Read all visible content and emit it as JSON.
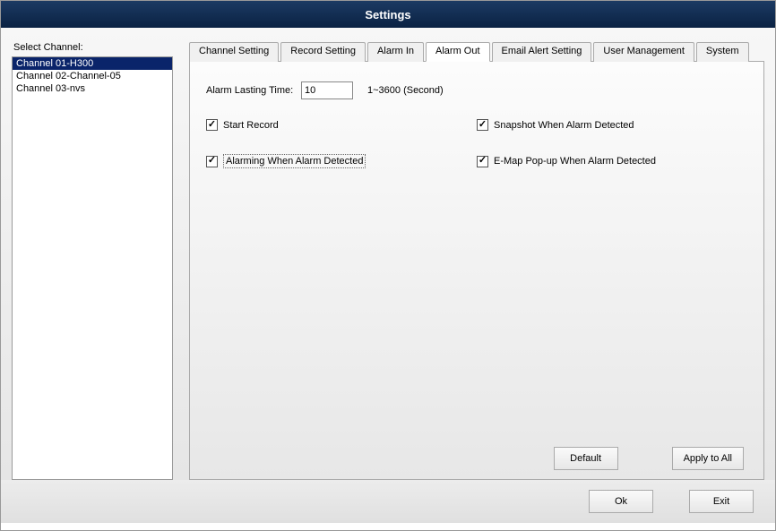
{
  "window": {
    "title": "Settings"
  },
  "sidebar": {
    "label": "Select Channel:",
    "channels": [
      {
        "label": "Channel 01-H300",
        "selected": true
      },
      {
        "label": "Channel 02-Channel-05",
        "selected": false
      },
      {
        "label": "Channel 03-nvs",
        "selected": false
      }
    ]
  },
  "tabs": {
    "items": [
      {
        "label": "Channel Setting",
        "active": false
      },
      {
        "label": "Record Setting",
        "active": false
      },
      {
        "label": "Alarm In",
        "active": false
      },
      {
        "label": "Alarm Out",
        "active": true
      },
      {
        "label": "Email Alert Setting",
        "active": false
      },
      {
        "label": "User Management",
        "active": false
      },
      {
        "label": "System",
        "active": false
      }
    ]
  },
  "alarm_out": {
    "lasting_label": "Alarm Lasting Time:",
    "lasting_value": "10",
    "lasting_range": "1~3600 (Second)",
    "start_record": {
      "label": "Start Record",
      "checked": true
    },
    "snapshot": {
      "label": "Snapshot When Alarm Detected",
      "checked": true
    },
    "alarming": {
      "label": "Alarming When Alarm Detected",
      "checked": true,
      "focused": true
    },
    "emap": {
      "label": "E-Map Pop-up When Alarm Detected",
      "checked": true
    }
  },
  "buttons": {
    "default": "Default",
    "apply_all": "Apply to All",
    "ok": "Ok",
    "exit": "Exit"
  }
}
